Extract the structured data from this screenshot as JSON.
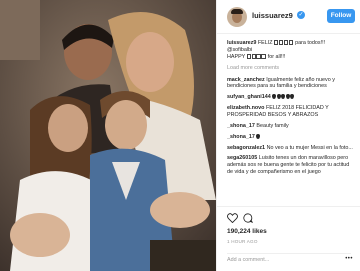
{
  "header": {
    "username": "luissuarez9",
    "verified_mark": "✓",
    "follow_label": "Follow"
  },
  "caption": {
    "username": "luissuarez9",
    "line1_before": "FELIZ",
    "line1_boxes": 4,
    "line1_after": "para todos!!!",
    "line2": "@sofibalbi",
    "line3_before": "HAPPY",
    "line3_boxes": 4,
    "line3_after": "for all!!!"
  },
  "load_more": "Load more comments",
  "comments": [
    {
      "user": "mack_zanchez",
      "text": "Igualmente feliz año nuevo y bendiciones para su familia y bendiciones"
    },
    {
      "user": "sufyan_ghani144",
      "text": "",
      "drops": 5
    },
    {
      "user": "elizabeth.novo",
      "text": "FELIZ 2018 FELICIDAD Y PROSPERIDAD BESOS Y ABRAZOS"
    },
    {
      "user": "_shona_17",
      "text": "Beauty family"
    },
    {
      "user": "_shona_17",
      "text": "",
      "drops": 1
    },
    {
      "user": "sebagonzalez1",
      "text": "No veo a tu mujer Messi en la foto..."
    },
    {
      "user": "sega260105",
      "text": "Luisito tenes un don maravilloso pero además sos re buena gente te felicito por tu actitud de vida y de compañerismo en el juego"
    }
  ],
  "likes": "190,224 likes",
  "time": "1 HOUR AGO",
  "add_comment_placeholder": "Add a comment...",
  "more_options": "•••",
  "colors": {
    "accent": "#3897f0",
    "muted": "#999999",
    "text": "#262626"
  },
  "icons": {
    "like": "heart-icon",
    "comment": "comment-icon",
    "more": "more-options-icon"
  }
}
